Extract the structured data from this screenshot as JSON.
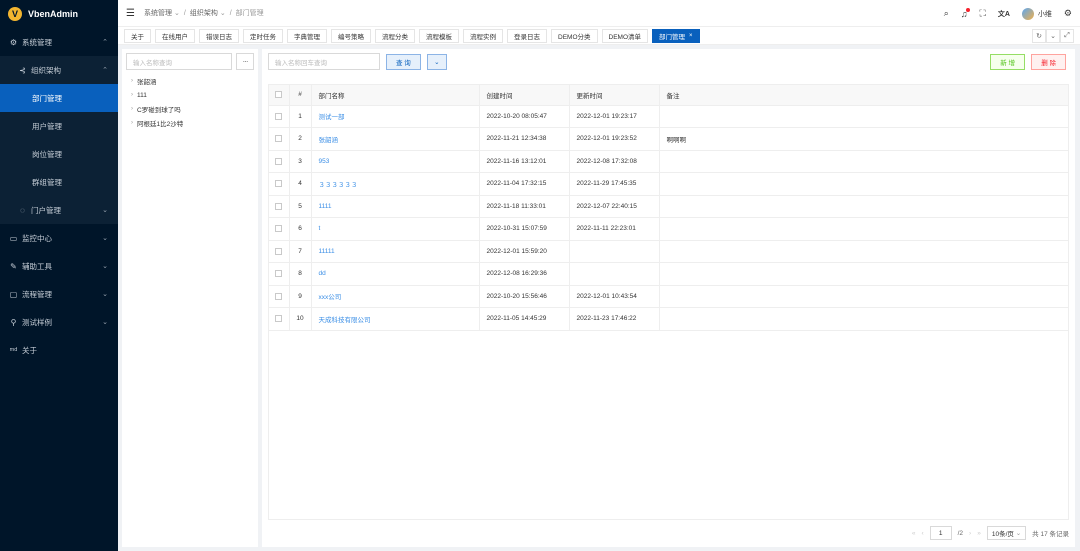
{
  "app": {
    "name": "VbenAdmin",
    "logo_letter": "V"
  },
  "sidebar": {
    "items": [
      {
        "icon": "gear-icon",
        "glyph": "⚙",
        "label": "系统管理",
        "chevron": "⌃"
      },
      {
        "icon": "org-icon",
        "glyph": "⊰",
        "label": "组织架构",
        "chevron": "⌃"
      },
      {
        "label": "部门管理"
      },
      {
        "label": "用户管理"
      },
      {
        "label": "岗位管理"
      },
      {
        "label": "群组管理"
      },
      {
        "icon": "portal-icon",
        "glyph": "◌",
        "label": "门户管理",
        "chevron": "⌄"
      },
      {
        "icon": "monitor-icon",
        "glyph": "▭",
        "label": "监控中心",
        "chevron": "⌄"
      },
      {
        "icon": "tool-icon",
        "glyph": "✎",
        "label": "辅助工具",
        "chevron": "⌄"
      },
      {
        "icon": "flow-icon",
        "glyph": "▢",
        "label": "流程管理",
        "chevron": "⌄"
      },
      {
        "icon": "cup-icon",
        "glyph": "⚲",
        "label": "测试样例",
        "chevron": "⌄"
      },
      {
        "icon": "md-icon",
        "glyph": "md",
        "label": "关于"
      }
    ]
  },
  "header": {
    "breadcrumb": [
      "系统管理",
      "组织架构",
      "部门管理"
    ],
    "breadcrumb_sep": "/",
    "dropdown_glyph": "⌄",
    "username": "小维",
    "icons": {
      "search": "⌕",
      "bell": "♫",
      "fullscreen": "⛶",
      "translate": "文A",
      "settings": "⚙"
    }
  },
  "tabs": {
    "items": [
      "关于",
      "在线用户",
      "错误日志",
      "定时任务",
      "字典管理",
      "编号策略",
      "流程分类",
      "流程模板",
      "流程实例",
      "登录日志",
      "DEMO分类",
      "DEMO清单",
      "部门管理"
    ],
    "active_index": 12,
    "close_glyph": "×",
    "tools": [
      "↻",
      "⌄",
      "⤢"
    ]
  },
  "tree": {
    "search_placeholder": "输入名称查询",
    "more_glyph": "···",
    "nodes": [
      "张韶涵",
      "111",
      "C罗碰到球了吗",
      "阿根廷1比2沙特"
    ],
    "arrow": "›"
  },
  "main": {
    "search_placeholder": "输入名称回车查询",
    "query_label": "查 询",
    "expand_glyph": "⌄",
    "add_label": "新 增",
    "delete_label": "删 除",
    "columns": [
      "#",
      "部门名称",
      "创建时间",
      "更新时间",
      "备注"
    ],
    "rows": [
      {
        "idx": "1",
        "name": "测试一部",
        "created": "2022-10-20 08:05:47",
        "updated": "2022-12-01 19:23:17",
        "remark": ""
      },
      {
        "idx": "2",
        "name": "张韶涵",
        "created": "2022-11-21 12:34:38",
        "updated": "2022-12-01 19:23:52",
        "remark": "啊啊啊"
      },
      {
        "idx": "3",
        "name": "953",
        "created": "2022-11-16 13:12:01",
        "updated": "2022-12-08 17:32:08",
        "remark": ""
      },
      {
        "idx": "4",
        "name": "３３３３３３",
        "created": "2022-11-04 17:32:15",
        "updated": "2022-11-29 17:45:35",
        "remark": ""
      },
      {
        "idx": "5",
        "name": "1111",
        "created": "2022-11-18 11:33:01",
        "updated": "2022-12-07 22:40:15",
        "remark": ""
      },
      {
        "idx": "6",
        "name": "t",
        "created": "2022-10-31 15:07:59",
        "updated": "2022-11-11 22:23:01",
        "remark": ""
      },
      {
        "idx": "7",
        "name": "11111",
        "created": "2022-12-01 15:59:20",
        "updated": "",
        "remark": ""
      },
      {
        "idx": "8",
        "name": "dd",
        "created": "2022-12-08 16:29:36",
        "updated": "",
        "remark": ""
      },
      {
        "idx": "9",
        "name": "xxx公司",
        "created": "2022-10-20 15:56:46",
        "updated": "2022-12-01 10:43:54",
        "remark": ""
      },
      {
        "idx": "10",
        "name": "天成科技有限公司",
        "created": "2022-11-05 14:45:29",
        "updated": "2022-11-23 17:46:22",
        "remark": ""
      }
    ],
    "pager": {
      "prev_first": "«",
      "prev": "‹",
      "page": "1",
      "total_pages": "/2",
      "next": "›",
      "next_last": "»",
      "page_size": "10条/页",
      "total": "共 17 条记录"
    }
  },
  "colors": {
    "sidebar_bg": "#001529",
    "primary": "#0960bd",
    "add": "#52c41a",
    "delete": "#f5222d",
    "link": "#3a8ee6"
  }
}
